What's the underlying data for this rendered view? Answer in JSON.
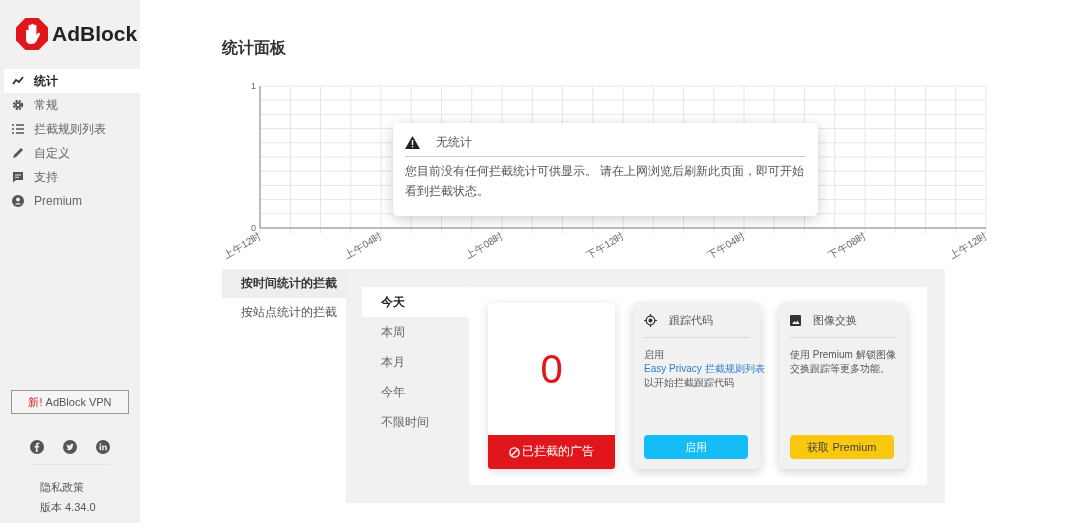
{
  "brand": "AdBlock",
  "sidebar": {
    "items": [
      {
        "label": "统计",
        "selected": true
      },
      {
        "label": "常规",
        "selected": false
      },
      {
        "label": "拦截规则列表",
        "selected": false
      },
      {
        "label": "自定义",
        "selected": false
      },
      {
        "label": "支持",
        "selected": false
      },
      {
        "label": "Premium",
        "selected": false
      }
    ],
    "vpn_button": {
      "badge": "新!",
      "label": "AdBlock VPN"
    },
    "privacy": "隐私政策",
    "version": "版本 4.34.0"
  },
  "page_title": "统计面板",
  "chart": {
    "chart_data": {
      "type": "line",
      "categories": [
        "上午12时",
        "上午04时",
        "上午08时",
        "下午12时",
        "下午04时",
        "下午08时",
        "上午12时"
      ],
      "ylim": [
        0,
        1
      ],
      "yticks": [
        0,
        1
      ]
    }
  },
  "alert": {
    "title": "无统计",
    "message": "您目前没有任何拦截统计可供显示。 请在上网浏览后刷新此页面，即可开始看到拦截状态。"
  },
  "main_tabs": [
    {
      "label": "按时间统计的拦截",
      "selected": true
    },
    {
      "label": "按站点统计的拦截",
      "selected": false
    }
  ],
  "periods": [
    {
      "label": "今天",
      "selected": true
    },
    {
      "label": "本周",
      "selected": false
    },
    {
      "label": "本月",
      "selected": false
    },
    {
      "label": "今年",
      "selected": false
    },
    {
      "label": "不限时间",
      "selected": false
    }
  ],
  "count_card": {
    "value": "0",
    "label": "已拦截的广告"
  },
  "feature_cards": [
    {
      "title": "跟踪代码",
      "before": "启用 ",
      "link": "Easy Privacy 拦截规则列表",
      "after": "以开始拦截跟踪代码",
      "button": "启用"
    },
    {
      "title": "图像交换",
      "before": "使用 Premium 解锁图像交换跟踪等更多功能。",
      "button": "获取 Premium"
    }
  ]
}
